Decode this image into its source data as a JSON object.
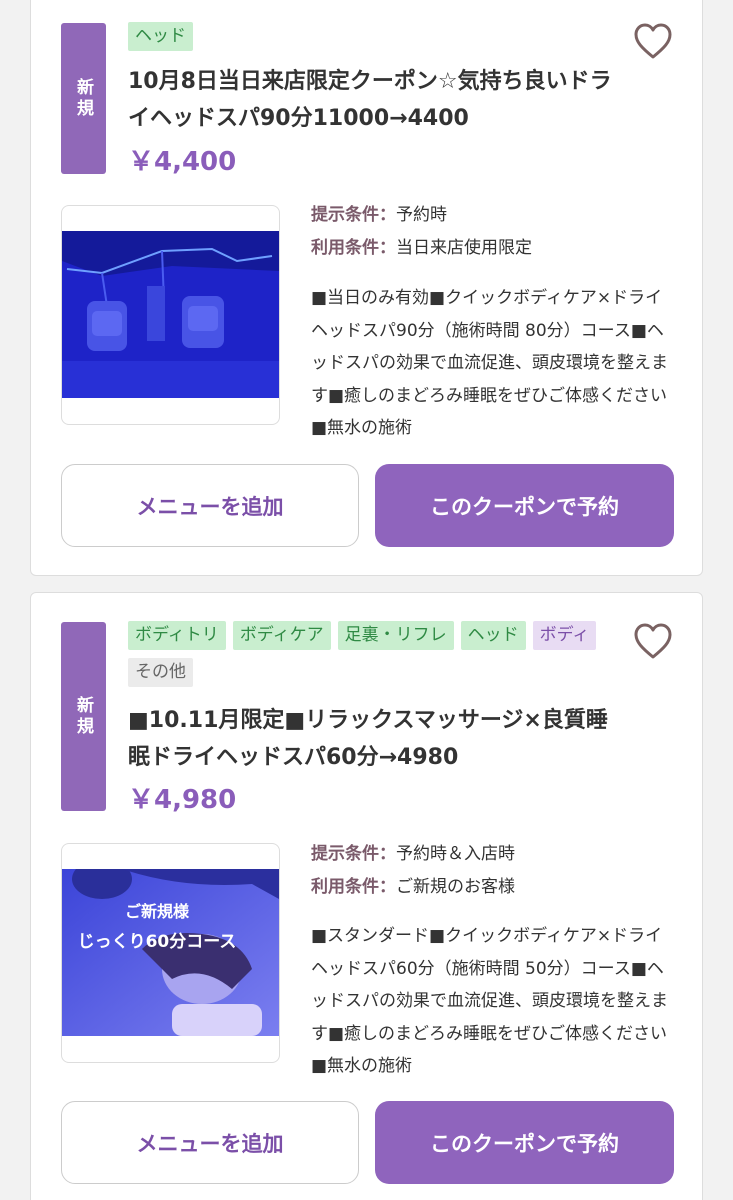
{
  "coupons": [
    {
      "new_badge": "新規",
      "tags": [
        {
          "label": "ヘッド",
          "style": "green"
        }
      ],
      "title": "10月8日当日来店限定クーポン☆気持ち良いドライヘッドスパ90分11000→4400",
      "price": "￥4,400",
      "conditions": [
        {
          "label": "提示条件：",
          "value": "予約時"
        },
        {
          "label": "利用条件：",
          "value": "当日来店使用限定"
        }
      ],
      "description": "■当日のみ有効■クイックボディケア×ドライヘッドスパ90分（施術時間 80分）コース■ヘッドスパの効果で血流促進、頭皮環境を整えます■癒しのまどろみ睡眠をぜひご体感ください■無水の施術",
      "menu_button": "メニューを追加",
      "reserve_button": "このクーポンで予約"
    },
    {
      "new_badge": "新規",
      "tags": [
        {
          "label": "ボディトリ",
          "style": "green"
        },
        {
          "label": "ボディケア",
          "style": "green"
        },
        {
          "label": "足裏・リフレ",
          "style": "green"
        },
        {
          "label": "ヘッド",
          "style": "green"
        },
        {
          "label": "ボディ",
          "style": "purple"
        },
        {
          "label": "その他",
          "style": "gray"
        }
      ],
      "title": "■10.11月限定■リラックスマッサージ×良質睡眠ドライヘッドスパ60分→4980",
      "price": "￥4,980",
      "image_caption_line1": "ご新規様",
      "image_caption_line2": "じっくり60分コース",
      "conditions": [
        {
          "label": "提示条件：",
          "value": "予約時＆入店時"
        },
        {
          "label": "利用条件：",
          "value": "ご新規のお客様"
        }
      ],
      "description": "■スタンダード■クイックボディケア×ドライヘッドスパ60分（施術時間 50分）コース■ヘッドスパの効果で血流促進、頭皮環境を整えます■癒しのまどろみ睡眠をぜひご体感ください■無水の施術",
      "menu_button": "メニューを追加",
      "reserve_button": "このクーポンで予約"
    }
  ],
  "colors": {
    "accent": "#8f64bd",
    "tag_green_bg": "#c9eecf",
    "tag_purple_bg": "#e8dcf3"
  },
  "icons": {
    "favorite": "heart-outline-icon"
  }
}
